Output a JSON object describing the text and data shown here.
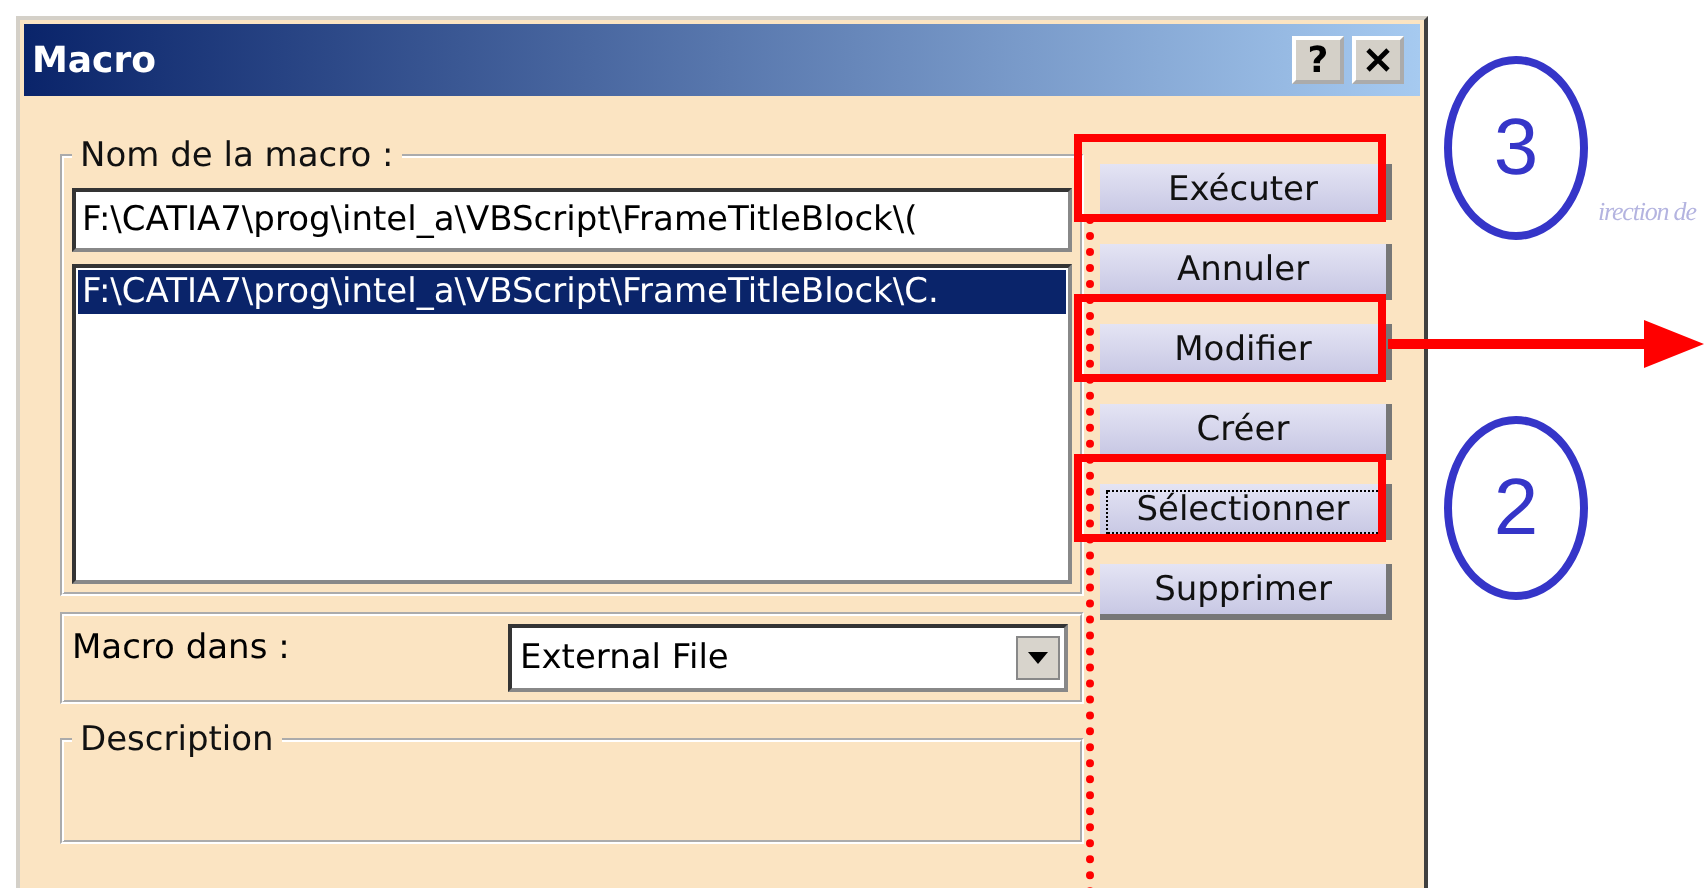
{
  "window": {
    "title": "Macro",
    "help": "?"
  },
  "name_group": {
    "legend": "Nom de la macro :",
    "value": "F:\\CATIA7\\prog\\intel_a\\VBScript\\FrameTitleBlock\\(",
    "list": [
      {
        "text": "F:\\CATIA7\\prog\\intel_a\\VBScript\\FrameTitleBlock\\C.",
        "selected": true
      }
    ]
  },
  "location": {
    "label": "Macro dans :",
    "value": "External File"
  },
  "description": {
    "legend": "Description"
  },
  "buttons": [
    {
      "label": "Exécuter",
      "focused": false,
      "boxed": true
    },
    {
      "label": "Annuler",
      "focused": false,
      "boxed": false
    },
    {
      "label": "Modifier",
      "focused": false,
      "boxed": true
    },
    {
      "label": "Créer",
      "focused": false,
      "boxed": false
    },
    {
      "label": "Sélectionner",
      "focused": true,
      "boxed": true
    },
    {
      "label": "Supprimer",
      "focused": false,
      "boxed": false
    }
  ],
  "callouts": [
    {
      "label": "3"
    },
    {
      "label": "2"
    }
  ],
  "background_text": "irection de"
}
